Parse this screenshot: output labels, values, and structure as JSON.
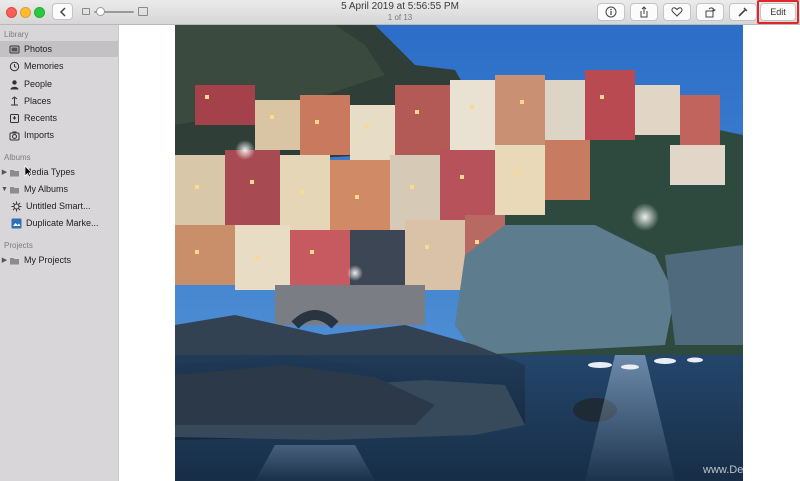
{
  "window": {
    "title": "5 April 2019 at 5:56:55 PM",
    "subtitle": "1 of 13"
  },
  "toolbar": {
    "edit_label": "Edit",
    "buttons": [
      "info-icon",
      "share-icon",
      "heart-icon",
      "rotate-icon",
      "tools-icon"
    ]
  },
  "sidebar": {
    "library_heading": "Library",
    "library_items": [
      {
        "label": "Photos",
        "icon": "photos-icon",
        "selected": true
      },
      {
        "label": "Memories",
        "icon": "memories-icon"
      },
      {
        "label": "People",
        "icon": "people-icon"
      },
      {
        "label": "Places",
        "icon": "places-icon"
      },
      {
        "label": "Recents",
        "icon": "recents-icon"
      },
      {
        "label": "Imports",
        "icon": "imports-icon"
      }
    ],
    "albums_heading": "Albums",
    "album_items": [
      {
        "label": "Media Types",
        "icon": "folder-icon"
      },
      {
        "label": "My Albums",
        "icon": "folder-icon"
      },
      {
        "label": "Untitled Smart...",
        "icon": "smart-album-icon"
      },
      {
        "label": "Duplicate Marke...",
        "icon": "album-icon"
      }
    ],
    "projects_heading": "Projects",
    "project_items": [
      {
        "label": "My Projects",
        "icon": "folder-icon"
      }
    ]
  },
  "photo": {
    "watermark": "www.De"
  },
  "colors": {
    "highlight": "#e0262a",
    "sidebar_bg": "#d8d6d8",
    "selected_bg": "#c3c1c3"
  }
}
